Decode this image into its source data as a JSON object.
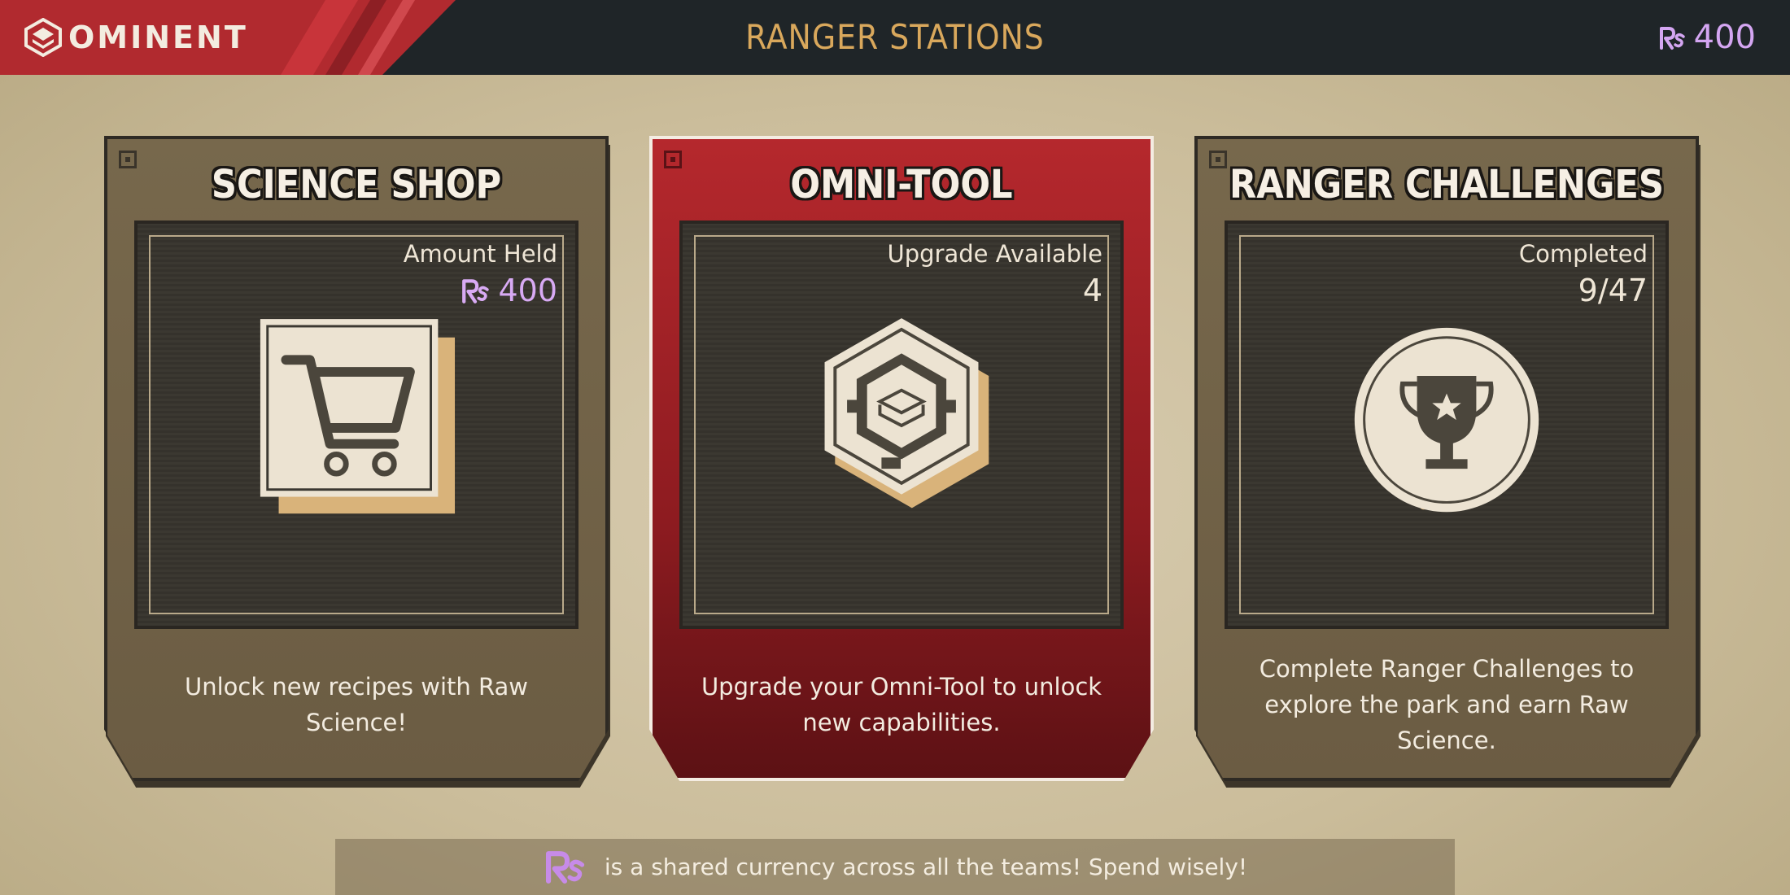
{
  "header": {
    "brand": "OMINENT",
    "title": "RANGER STATIONS",
    "currency_value": "400"
  },
  "cards": [
    {
      "title": "SCIENCE SHOP",
      "stat_label": "Amount Held",
      "stat_value": "400",
      "icon": "shopping-cart-icon",
      "description": "Unlock new recipes with Raw Science!"
    },
    {
      "title": "OMNI-TOOL",
      "stat_label": "Upgrade Available",
      "stat_value": "4",
      "icon": "omni-tool-hexagon-icon",
      "description": "Upgrade your Omni-Tool to unlock new capabilities."
    },
    {
      "title": "RANGER CHALLENGES",
      "stat_label": "Completed",
      "stat_value": "9/47",
      "icon": "trophy-icon",
      "description": "Complete Ranger Challenges to explore the park and earn Raw Science."
    }
  ],
  "footer": {
    "text": "is a shared currency across all the teams! Spend wisely!"
  },
  "colors": {
    "brand_red": "#b12a2f",
    "title_gold": "#d9a85c",
    "currency_purple": "#d4a6f2",
    "selected_card": "#a52328",
    "card_brown": "#6f6148"
  },
  "selected_card": "OMNI-TOOL"
}
